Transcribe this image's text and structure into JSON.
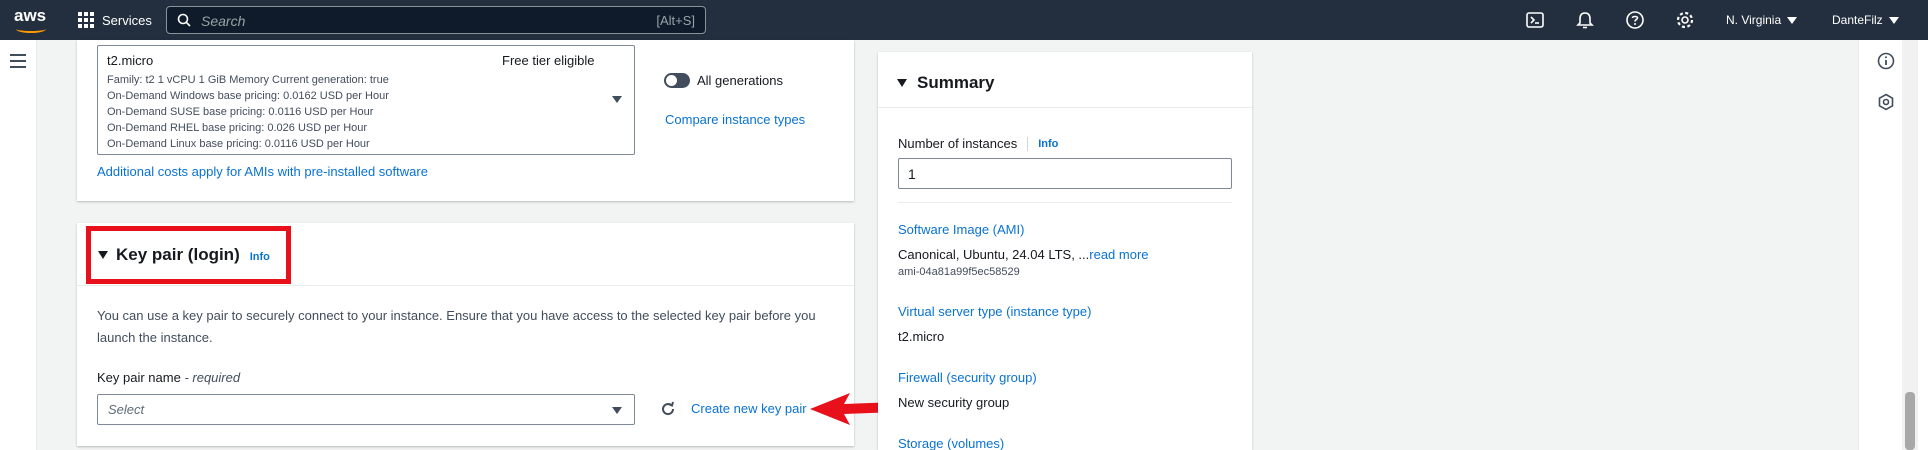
{
  "topnav": {
    "logo": "aws",
    "services_label": "Services",
    "search_placeholder": "Search",
    "search_shortcut": "[Alt+S]",
    "region": "N. Virginia",
    "user": "DanteFilz",
    "icons": [
      "cloudshell-icon",
      "bell-icon",
      "help-icon",
      "gear-icon"
    ]
  },
  "instance_type": {
    "name": "t2.micro",
    "free_tier": "Free tier eligible",
    "family_line": "Family: t2    1 vCPU    1 GiB Memory    Current generation: true",
    "pricing": [
      "On-Demand Windows base pricing: 0.0162 USD per Hour",
      "On-Demand SUSE base pricing: 0.0116 USD per Hour",
      "On-Demand RHEL base pricing: 0.026 USD per Hour",
      "On-Demand Linux base pricing: 0.0116 USD per Hour"
    ],
    "all_generations_label": "All generations",
    "compare_link": "Compare instance types",
    "additional_costs_link": "Additional costs apply for AMIs with pre-installed software"
  },
  "key_pair": {
    "title": "Key pair (login)",
    "info": "Info",
    "description": "You can use a key pair to securely connect to your instance. Ensure that you have access to the selected key pair before you launch the instance.",
    "name_label": "Key pair name",
    "required_label": "- required",
    "select_placeholder": "Select",
    "create_link": "Create new key pair"
  },
  "summary": {
    "title": "Summary",
    "num_instances_label": "Number of instances",
    "info": "Info",
    "num_instances_value": "1",
    "ami_label": "Software Image (AMI)",
    "ami_value": "Canonical, Ubuntu, 24.04 LTS, ...",
    "read_more": "read more",
    "ami_id": "ami-04a81a99f5ec58529",
    "server_type_label": "Virtual server type (instance type)",
    "server_type_value": "t2.micro",
    "firewall_label": "Firewall (security group)",
    "firewall_value": "New security group",
    "storage_label": "Storage (volumes)"
  },
  "colors": {
    "nav_bg": "#232f3e",
    "link": "#0972d3",
    "highlight_red": "#e8101a",
    "arrow_red": "#e8101a"
  }
}
